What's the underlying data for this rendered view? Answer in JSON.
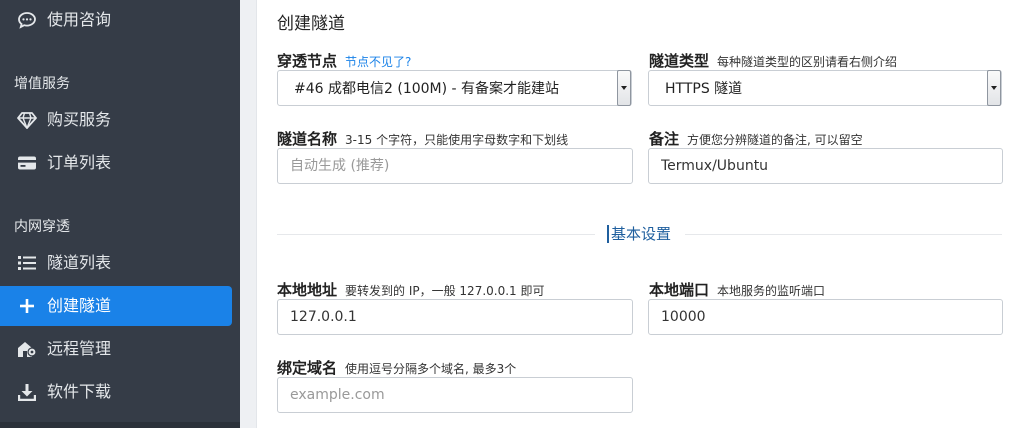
{
  "sidebar": {
    "top_item": {
      "label": "使用咨询",
      "icon": "chat-icon"
    },
    "sections": [
      {
        "title": "增值服务",
        "items": [
          {
            "label": "购买服务",
            "icon": "diamond-icon"
          },
          {
            "label": "订单列表",
            "icon": "credit-card-icon"
          }
        ]
      },
      {
        "title": "内网穿透",
        "items": [
          {
            "label": "隧道列表",
            "icon": "list-icon"
          },
          {
            "label": "创建隧道",
            "icon": "plus-icon",
            "active": true
          },
          {
            "label": "远程管理",
            "icon": "remote-icon"
          },
          {
            "label": "软件下载",
            "icon": "download-icon"
          }
        ]
      }
    ]
  },
  "card": {
    "title": "创建隧道",
    "node": {
      "label": "穿透节点",
      "link": "节点不见了?",
      "value": "#46 成都电信2 (100M) - 有备案才能建站"
    },
    "tunnel_type": {
      "label": "隧道类型",
      "hint": "每种隧道类型的区别请看右侧介绍",
      "value": "HTTPS 隧道"
    },
    "tunnel_name": {
      "label": "隧道名称",
      "hint": "3-15 个字符，只能使用字母数字和下划线",
      "placeholder": "自动生成 (推荐)"
    },
    "remark": {
      "label": "备注",
      "hint": "方便您分辨隧道的备注, 可以留空",
      "value": "Termux/Ubuntu"
    },
    "divider": "基本设置",
    "local_address": {
      "label": "本地地址",
      "hint": "要转发到的 IP，一般 127.0.0.1 即可",
      "value": "127.0.0.1"
    },
    "local_port": {
      "label": "本地端口",
      "hint": "本地服务的监听端口",
      "value": "10000"
    },
    "domain": {
      "label": "绑定域名",
      "hint": "使用逗号分隔多个域名, 最多3个",
      "placeholder": "example.com"
    }
  },
  "colors": {
    "sidebar_bg": "#353c47",
    "accent": "#1a82e8",
    "divider_text": "#1f5f9e"
  }
}
